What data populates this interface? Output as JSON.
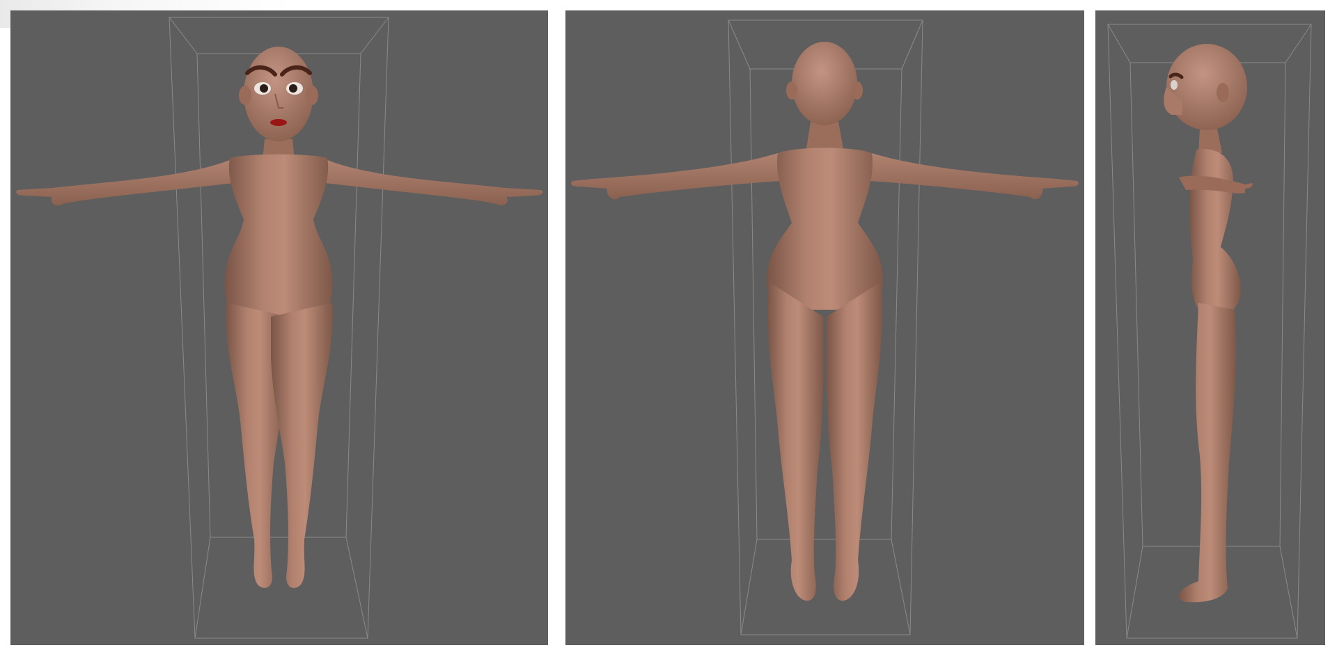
{
  "image": {
    "panels": [
      {
        "view": "front-view"
      },
      {
        "view": "back-view"
      },
      {
        "view": "side-view"
      }
    ],
    "colors": {
      "background": "#5e5e5e",
      "skin": "#a57766",
      "skin_shadow": "#7a5547",
      "skin_highlight": "#c09080",
      "bounding_box": "#8a8a8a",
      "brows": "#4a2418",
      "lips": "#9a1616",
      "page": "#ffffff"
    }
  }
}
